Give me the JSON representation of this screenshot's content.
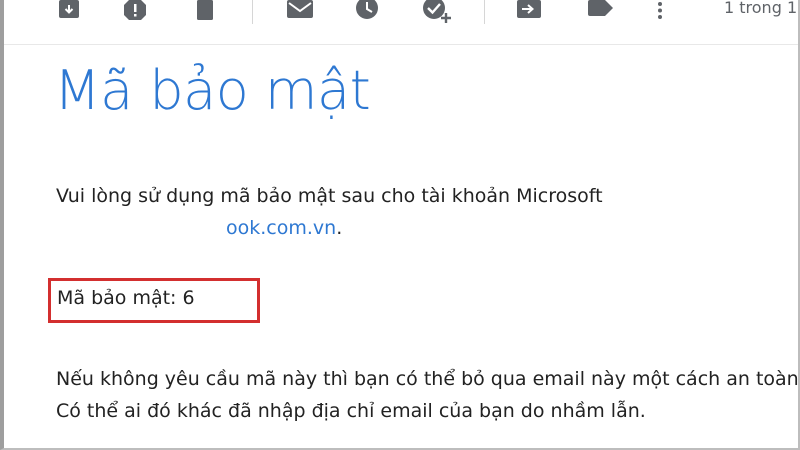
{
  "toolbar": {
    "icons": [
      {
        "name": "archive-icon"
      },
      {
        "name": "report-spam-icon"
      },
      {
        "name": "delete-icon"
      },
      {
        "name": "mark-unread-icon"
      },
      {
        "name": "snooze-icon"
      },
      {
        "name": "add-to-tasks-icon"
      },
      {
        "name": "move-to-icon"
      },
      {
        "name": "label-icon"
      },
      {
        "name": "more-options-icon"
      }
    ],
    "pager_text": "1 trong 1"
  },
  "email": {
    "heading": "Mã bảo mật",
    "intro_line": "Vui lòng sử dụng mã bảo mật sau cho tài khoản Microsoft",
    "account_email": "ook.com.vn",
    "account_suffix": ".",
    "code_label": "Mã bảo mật: 6",
    "footer_line1": "Nếu không yêu cầu mã này thì bạn có thể bỏ qua email này một cách an toàn.",
    "footer_line2": "Có thể ai đó khác đã nhập địa chỉ email của bạn do nhầm lẫn."
  },
  "colors": {
    "accent": "#2e78d2",
    "highlight_box": "#d32f2f",
    "icon": "#5f6368"
  }
}
